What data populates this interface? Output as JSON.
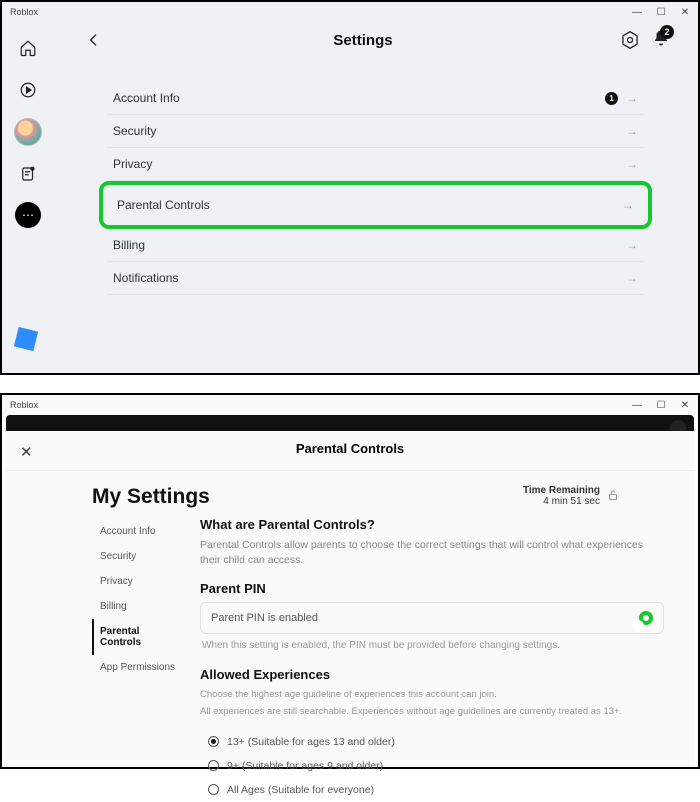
{
  "topWindow": {
    "appName": "Roblox",
    "pageTitle": "Settings",
    "bellCount": "2",
    "rows": [
      {
        "label": "Account Info",
        "badge": "1"
      },
      {
        "label": "Security"
      },
      {
        "label": "Privacy"
      },
      {
        "label": "Parental Controls",
        "highlighted": true
      },
      {
        "label": "Billing"
      },
      {
        "label": "Notifications"
      }
    ]
  },
  "bottomWindow": {
    "appName": "Roblox",
    "modalTitle": "Parental Controls",
    "mySettings": "My Settings",
    "timeRemaining": {
      "label": "Time Remaining",
      "value": "4 min 51 sec"
    },
    "tabs": [
      "Account Info",
      "Security",
      "Privacy",
      "Billing",
      "Parental Controls",
      "App Permissions"
    ],
    "activeTab": "Parental Controls",
    "section1": {
      "title": "What are Parental Controls?",
      "desc": "Parental Controls allow parents to choose the correct settings that will control what experiences their child can access."
    },
    "pin": {
      "title": "Parent PIN",
      "rowLabel": "Parent PIN is enabled",
      "note": "When this setting is enabled, the PIN must be provided before changing settings."
    },
    "allowed": {
      "title": "Allowed Experiences",
      "desc1": "Choose the highest age guideline of experiences this account can join.",
      "desc2": "All experiences are still searchable. Experiences without age guidelines are currently treated as 13+.",
      "options": [
        {
          "label": "13+ (Suitable for ages 13 and older)",
          "selected": true
        },
        {
          "label": "9+ (Suitable for ages 9 and older)"
        },
        {
          "label": "All Ages (Suitable for everyone)"
        }
      ]
    }
  }
}
